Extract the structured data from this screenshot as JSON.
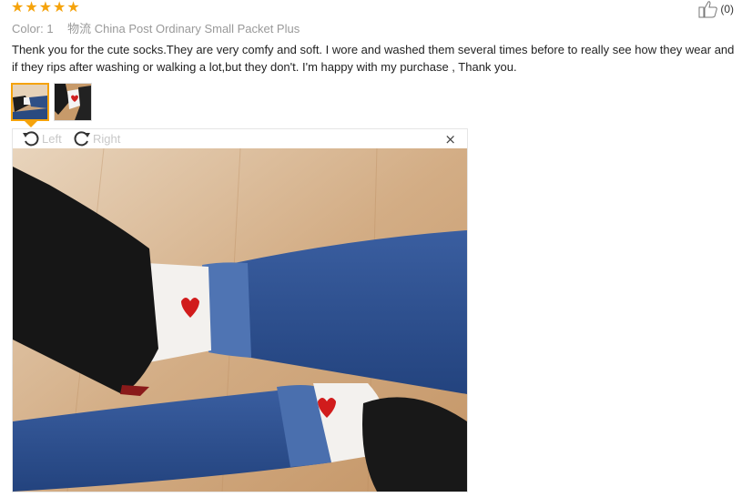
{
  "rating": {
    "stars": 5,
    "star_glyph": "★",
    "color": "#f5a30b"
  },
  "meta": {
    "color_label": "Color:",
    "color_value": "1",
    "shipping": "物流 China Post Ordinary Small Packet Plus"
  },
  "helpful": {
    "count": "(0)",
    "icon": "thumbs-up-icon"
  },
  "review_text": "Thenk you for the cute socks.They are very comfy and soft. I wore and washed them several times before to really see how they wear and if they rips after washing or walking a lot,but they don't. I'm happy with my purchase , Thank you.",
  "thumbnails": [
    {
      "name": "photo-1",
      "active": true
    },
    {
      "name": "photo-2",
      "active": false
    }
  ],
  "viewer": {
    "rotate_left_label": "Left",
    "rotate_right_label": "Right",
    "close_glyph": "×"
  }
}
